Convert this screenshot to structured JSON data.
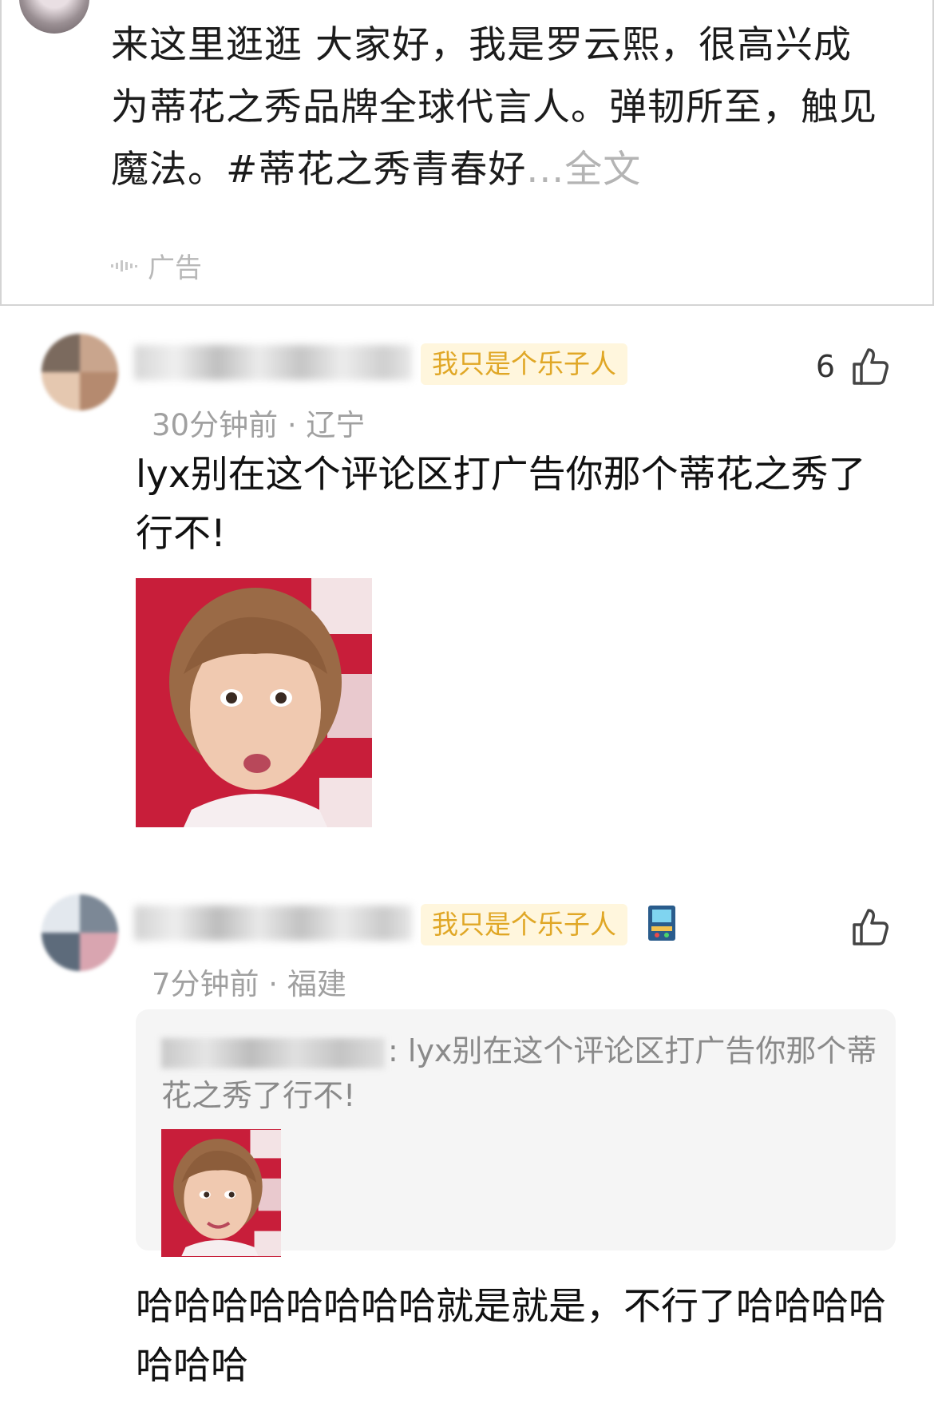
{
  "ad_post": {
    "text": "来这里逛逛 大家好，我是罗云熙，很高兴成为蒂花之秀品牌全球代言人。弹韧所至，触见魔法。#蒂花之秀青春好",
    "ellipsis": "...",
    "more_label": "全文",
    "ad_label": "广告"
  },
  "comments": [
    {
      "badge": "我只是个乐子人",
      "meta": "30分钟前 · 辽宁",
      "likes": "6",
      "text": "lyx别在这个评论区打广告你那个蒂花之秀了行不!"
    },
    {
      "badge": "我只是个乐子人",
      "meta": "7分钟前 · 福建",
      "likes": "",
      "quote": ": lyx别在这个评论区打广告你那个蒂花之秀了行不!",
      "text": "哈哈哈哈哈哈哈哈就是就是，不行了哈哈哈哈哈哈哈"
    }
  ],
  "colors": {
    "badge_bg": "#fff6dd",
    "badge_text": "#e0a726",
    "meta_text": "#a0a0a0",
    "photo_bg": "#c81e3a"
  },
  "icons": [
    "sound-icon",
    "thumbs-up-icon",
    "arcade-icon"
  ]
}
